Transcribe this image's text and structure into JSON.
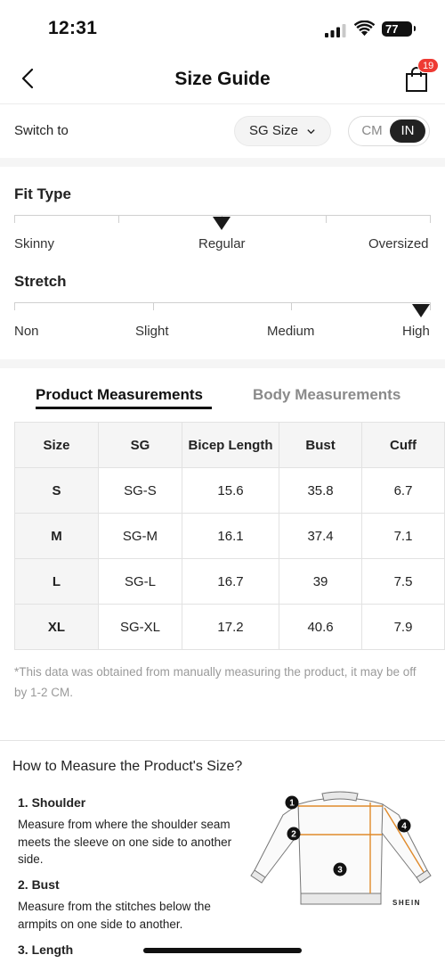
{
  "status_bar": {
    "time": "12:31",
    "battery": "77"
  },
  "nav": {
    "title": "Size Guide",
    "cart_count": "19"
  },
  "switch": {
    "label": "Switch to",
    "size_system": "SG Size",
    "unit_cm": "CM",
    "unit_in": "IN",
    "selected_unit": "IN"
  },
  "fit_type": {
    "title": "Fit Type",
    "options": [
      "Skinny",
      "Regular",
      "Oversized"
    ],
    "selected": "Regular"
  },
  "stretch": {
    "title": "Stretch",
    "options": [
      "Non",
      "Slight",
      "Medium",
      "High"
    ],
    "selected": "High"
  },
  "tabs": {
    "product": "Product Measurements",
    "body": "Body Measurements",
    "active": "Product Measurements"
  },
  "table": {
    "headers": [
      "Size",
      "SG",
      "Bicep Length",
      "Bust",
      "Cuff"
    ],
    "rows": [
      [
        "S",
        "SG-S",
        "15.6",
        "35.8",
        "6.7"
      ],
      [
        "M",
        "SG-M",
        "16.1",
        "37.4",
        "7.1"
      ],
      [
        "L",
        "SG-L",
        "16.7",
        "39",
        "7.5"
      ],
      [
        "XL",
        "SG-XL",
        "17.2",
        "40.6",
        "7.9"
      ]
    ]
  },
  "note": "*This data was obtained from manually measuring the product, it may be off by 1-2 CM.",
  "measure": {
    "title": "How to Measure the Product's Size?",
    "steps": [
      {
        "title": "1. Shoulder",
        "desc": "Measure from where the shoulder seam meets the sleeve on one side to another side."
      },
      {
        "title": "2. Bust",
        "desc": "Measure from the stitches below the armpits on one side to another."
      },
      {
        "title": "3. Length",
        "desc": ""
      }
    ],
    "diagram_markers": [
      "1",
      "2",
      "3",
      "4"
    ],
    "brand": "SHEIN"
  },
  "colors": {
    "accent": "#111111",
    "badge": "#ee3a33",
    "measure_line": "#e08a2a",
    "muted": "#9a9a9a"
  }
}
